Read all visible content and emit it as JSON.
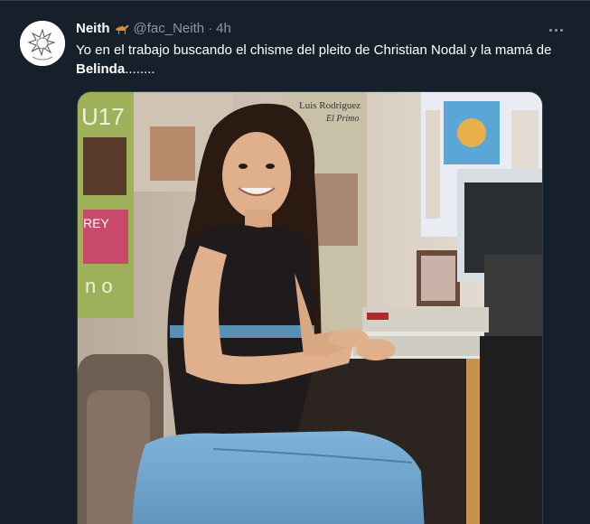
{
  "tweet": {
    "display_name": "Neith",
    "emoji_icon": "camel-icon",
    "handle": "@fac_Neith",
    "separator": "·",
    "time": "4h",
    "text_part1": "Yo en el trabajo buscando el chisme del pleito de Christian Nodal y la mamá de ",
    "text_bold": "Belinda",
    "text_part2": "........",
    "more_icon": "more-horizontal-icon"
  },
  "media": {
    "poster_text_left": "U17",
    "poster_text_left2": "n o",
    "poster_text_rey": "REY",
    "poster_text_top": "Luis Rodriguez",
    "poster_text_top2": "El Primo"
  },
  "colors": {
    "background": "#15202b",
    "border": "#38444d",
    "muted": "#8b98a5",
    "text": "#ffffff"
  }
}
